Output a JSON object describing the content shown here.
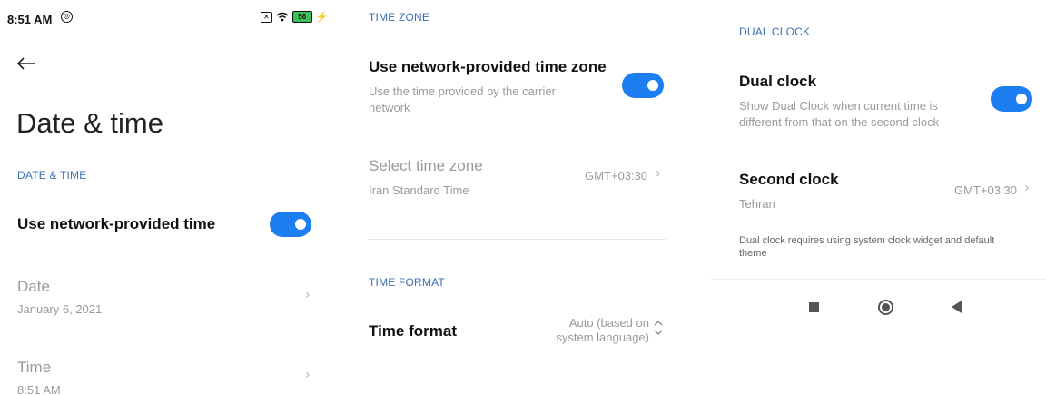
{
  "status_bar": {
    "time": "8:51 AM",
    "battery": "56"
  },
  "screen1": {
    "page_title": "Date & time",
    "section_label": "DATE & TIME",
    "network_time_label": "Use network-provided time",
    "date_label": "Date",
    "date_value": "January 6, 2021",
    "time_label": "Time",
    "time_value": "8:51 AM"
  },
  "screen2": {
    "section_timezone": "TIME ZONE",
    "network_tz_label": "Use network-provided time zone",
    "network_tz_desc_line1": "Use the time provided by the carrier",
    "network_tz_desc_line2": "network",
    "select_tz_label": "Select time zone",
    "select_tz_sub": "Iran Standard Time",
    "select_tz_value": "GMT+03:30",
    "section_timeformat": "TIME FORMAT",
    "time_format_label": "Time format",
    "time_format_value_line1": "Auto (based on",
    "time_format_value_line2": "system language)"
  },
  "screen3": {
    "section_dualclock": "DUAL CLOCK",
    "dual_clock_label": "Dual clock",
    "dual_clock_desc_line1": "Show Dual Clock when current time is",
    "dual_clock_desc_line2": "different from that on the second clock",
    "second_clock_label": "Second clock",
    "second_clock_sub": "Tehran",
    "second_clock_value": "GMT+03:30",
    "footnote_line1": "Dual clock requires using system clock widget and default",
    "footnote_line2": "theme"
  },
  "toggles": {
    "network_time": true,
    "network_timezone": true,
    "dual_clock": true
  },
  "colors": {
    "accent": "#1c7ef0",
    "section_label": "#3a6fb0",
    "muted_text": "#9a9a9a"
  },
  "icons": [
    "back-arrow-icon",
    "chevron-right-icon",
    "chevron-up-down-icon",
    "wifi-icon",
    "battery-icon",
    "nav-recents-icon",
    "nav-home-icon",
    "nav-back-icon"
  ]
}
